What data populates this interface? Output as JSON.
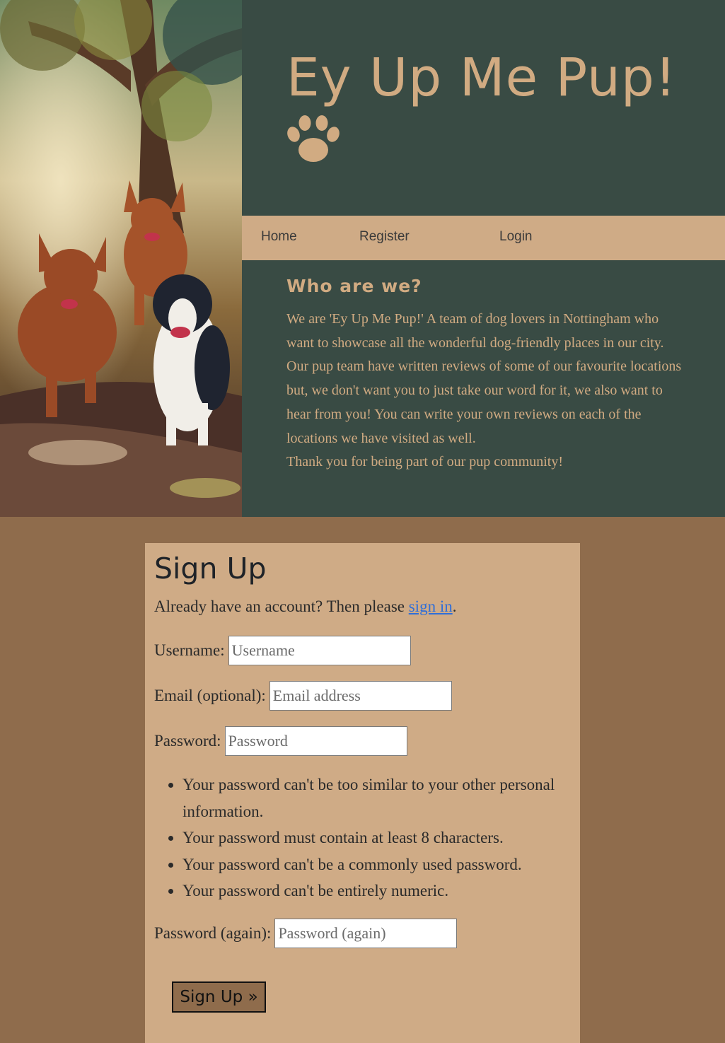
{
  "header": {
    "site_title": "Ey Up Me Pup!",
    "logo_icon": "paw-icon",
    "hero_image": "painting of dogs running through autumn woods"
  },
  "nav": {
    "items": [
      {
        "label": "Home"
      },
      {
        "label": "Register"
      },
      {
        "label": "Login"
      }
    ]
  },
  "about": {
    "title": "Who are we?",
    "paragraphs": [
      "We are 'Ey Up Me Pup!' A team of dog lovers in Nottingham who want to showcase all the wonderful dog-friendly places in our city.",
      "Our pup team have written reviews of some of our favourite locations but, we don't want you to just take our word for it, we also want to hear from you! You can write your own reviews on each of the locations we have visited as well.",
      "Thank you for being part of our pup community!"
    ]
  },
  "signup": {
    "title": "Sign Up",
    "already_text": "Already have an account? Then please ",
    "signin_link": "sign in",
    "already_suffix": ".",
    "fields": {
      "username": {
        "label": "Username:",
        "placeholder": "Username"
      },
      "email": {
        "label": "Email (optional):",
        "placeholder": "Email address"
      },
      "password": {
        "label": "Password:",
        "placeholder": "Password"
      },
      "password2": {
        "label": "Password (again):",
        "placeholder": "Password (again)"
      }
    },
    "help": [
      "Your password can't be too similar to your other personal information.",
      "Your password must contain at least 8 characters.",
      "Your password can't be a commonly used password.",
      "Your password can't be entirely numeric."
    ],
    "button_label": "Sign Up »"
  },
  "colors": {
    "header_bg": "#394b44",
    "accent_tan": "#cfab86",
    "page_bg": "#8f6c4c",
    "link_blue": "#2f6ed8"
  }
}
